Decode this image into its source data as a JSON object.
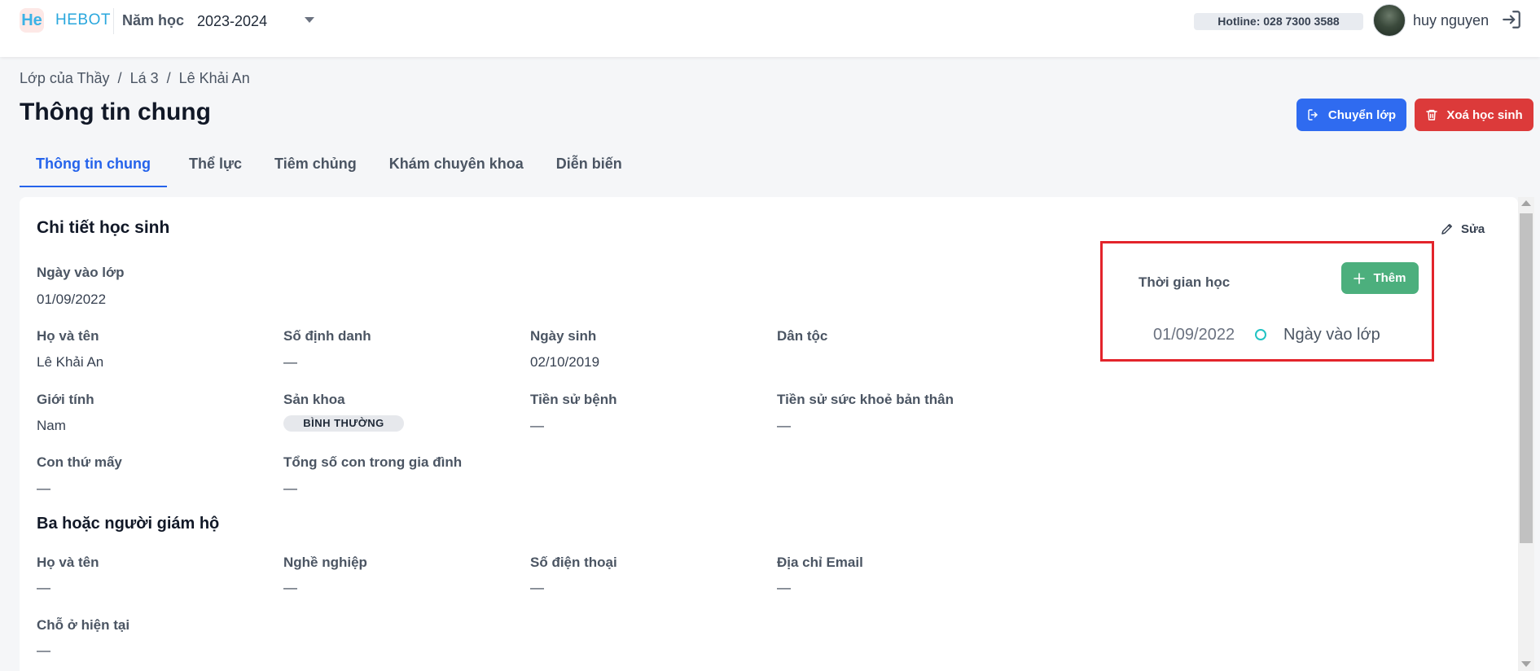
{
  "header": {
    "logo_mark": "He",
    "brand": "HEBOT",
    "year_label": "Năm học",
    "year_value": "2023-2024",
    "hotline": "Hotline: 028 7300 3588",
    "username": "huy nguyen",
    "icons": {
      "logout": "logout-icon",
      "chevron": "chevron-down-icon"
    }
  },
  "breadcrumb": {
    "items": [
      "Lớp của Thầy",
      "Lá 3",
      "Lê Khải An"
    ],
    "separator": "/"
  },
  "page": {
    "title": "Thông tin chung",
    "transfer_label": "Chuyển lớp",
    "delete_label": "Xoá học sinh"
  },
  "tabs": [
    {
      "label": "Thông tin chung",
      "active": true
    },
    {
      "label": "Thể lực",
      "active": false
    },
    {
      "label": "Tiêm chủng",
      "active": false
    },
    {
      "label": "Khám chuyên khoa",
      "active": false
    },
    {
      "label": "Diễn biến",
      "active": false
    }
  ],
  "details": {
    "section_title": "Chi tiết học sinh",
    "edit_label": "Sửa",
    "join_date_label": "Ngày vào lớp",
    "join_date_value": "01/09/2022",
    "full_name_label": "Họ và tên",
    "full_name_value": "Lê Khải An",
    "id_label": "Số định danh",
    "id_value": "—",
    "dob_label": "Ngày sinh",
    "dob_value": "02/10/2019",
    "ethnicity_label": "Dân tộc",
    "ethnicity_value": "",
    "gender_label": "Giới tính",
    "gender_value": "Nam",
    "obstetric_label": "Sản khoa",
    "obstetric_value": "BÌNH THƯỜNG",
    "disease_history_label": "Tiền sử bệnh",
    "disease_history_value": "—",
    "health_history_label": "Tiền sử sức khoẻ bản thân",
    "health_history_value": "—",
    "child_order_label": "Con thứ mấy",
    "child_order_value": "—",
    "total_children_label": "Tổng số con trong gia đình",
    "total_children_value": "—"
  },
  "guardian": {
    "section_title": "Ba hoặc người giám hộ",
    "name_label": "Họ và tên",
    "name_value": "—",
    "job_label": "Nghề nghiệp",
    "job_value": "—",
    "phone_label": "Số điện thoại",
    "phone_value": "—",
    "email_label": "Địa chỉ Email",
    "email_value": "—",
    "address_label": "Chỗ ở hiện tại",
    "address_value": "—"
  },
  "study_time": {
    "title": "Thời gian học",
    "add_label": "Thêm",
    "entries": [
      {
        "date": "01/09/2022",
        "event": "Ngày vào lớp"
      }
    ]
  },
  "colors": {
    "primary": "#2f6bf0",
    "danger": "#dc3a3a",
    "success": "#4caf7d",
    "highlight": "#e3242b",
    "timeline_dot": "#22c3c3"
  }
}
